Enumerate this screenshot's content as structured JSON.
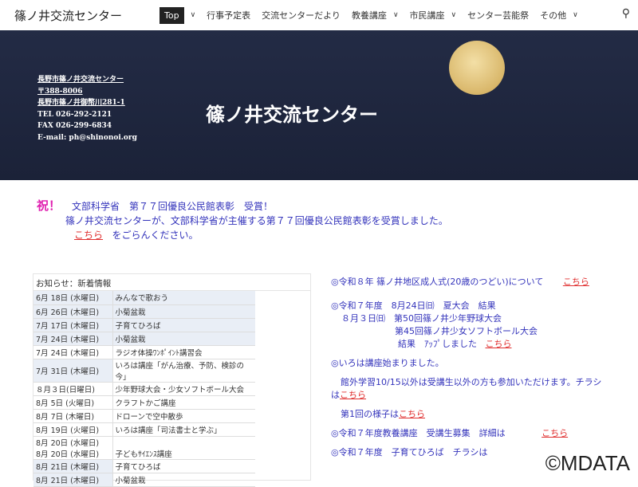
{
  "nav": {
    "brand": "篠ノ井交流センター",
    "items": [
      {
        "label": "Top",
        "dropdown": true,
        "active": true
      },
      {
        "label": "行事予定表",
        "dropdown": false
      },
      {
        "label": "交流センターだより",
        "dropdown": false
      },
      {
        "label": "教養講座",
        "dropdown": true
      },
      {
        "label": "市民講座",
        "dropdown": true
      },
      {
        "label": "センター芸能祭",
        "dropdown": false
      },
      {
        "label": "その他",
        "dropdown": true
      }
    ],
    "search_icon": "search-icon"
  },
  "hero": {
    "title": "篠ノ井交流センター",
    "address": [
      "長野市篠ノ井交流センター",
      "〒388-8006",
      "長野市篠ノ井御幣川281-1",
      "TEL 026-292-2121",
      "FAX 026-299-6834",
      "E-mail: ph@shinonoi.org"
    ]
  },
  "announcement": {
    "iwai": "祝！",
    "headline": "文部科学省　第７７回優良公民館表彰　受賞！",
    "body": "篠ノ井交流センターが、文部科学省が主催する第７７回優良公民館表彰を受賞しました。",
    "link": "こちら",
    "link_suffix": "をごらんください。"
  },
  "news": {
    "title": "お知らせ：新着情報",
    "rows": [
      {
        "date": "6月 18日 (水曜日)",
        "event": "みんなで歌おう"
      },
      {
        "date": "6月 26日 (木曜日)",
        "event": "小菊盆栽"
      },
      {
        "date": "7月 17日 (木曜日)",
        "event": "子育てひろば"
      },
      {
        "date": "7月 24日 (木曜日)",
        "event": "小菊盆栽"
      },
      {
        "date": "7月 24日 (木曜日)",
        "event": "ラジオ体操ﾜﾝﾎﾟｲﾝﾄ講習会"
      },
      {
        "date": "7月 31日 (木曜日)",
        "event": "いろは講座「がん治療、予防、検診の今」"
      },
      {
        "date": "８月３日(日曜日)",
        "event": "少年野球大会・少女ソフトボール大会"
      },
      {
        "date": "8月 5日 (火曜日)",
        "event": "クラフトかご講座"
      },
      {
        "date": "8月 7日 (木曜日)",
        "event": "ドローンで空中散歩"
      },
      {
        "date": "8月 19日 (火曜日)",
        "event": "いろは講座「司法書士と学ぶ」"
      },
      {
        "date": "8月 20日 (水曜日)",
        "date2": "8月 20日 (水曜日)",
        "event": "子どもｻｲｴﾝｽ講座"
      },
      {
        "date": "8月 21日 (木曜日)",
        "event": "子育てひろば"
      },
      {
        "date": "8月 21日 (木曜日)",
        "event": "小菊盆栽"
      }
    ]
  },
  "right": {
    "i1": "◎令和８年 篠ノ井地区成人式(20歳のつどい)について",
    "l1": "こちら",
    "i2a": "◎令和７年度　8月24日㈰　夏大会　結果",
    "i2b": "８月３日㈰　第50回篠ノ井少年野球大会",
    "i2c": "第45回篠ノ井少女ソフトボール大会",
    "i2d": "結果　ｱｯﾌﾟしました",
    "l2": "こちら",
    "i3": "◎いろは講座始まりました。",
    "i3b": "館外学習10/15以外は受講生以外の方も参加いただけます。チラシは",
    "l3": "こちら",
    "i3c": "第1回の様子は",
    "l3c": "こちら",
    "i4": "◎令和７年度教養講座　受講生募集　詳細は",
    "l4": "こちら",
    "i5": "◎令和７年度　子育てひろば　チラシは"
  },
  "watermark": "©MDATA"
}
